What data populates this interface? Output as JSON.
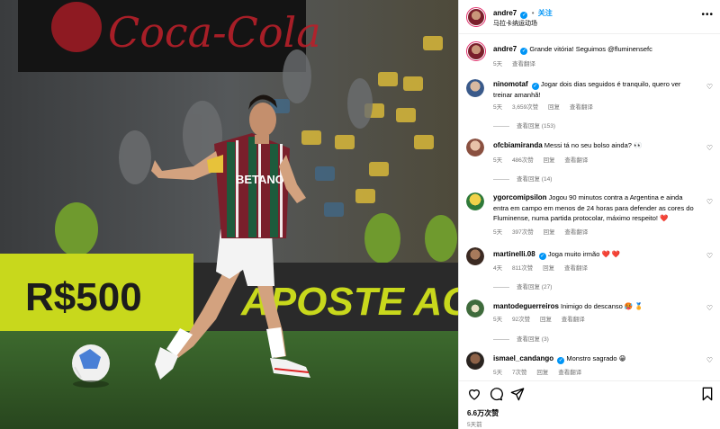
{
  "post": {
    "author": "andre7",
    "follow_label": "关注",
    "location": "马拉卡纳运动场",
    "caption_text": "Grande vitória! Seguimos @fluminensefc",
    "caption_time": "5天",
    "caption_translate": "查看翻译",
    "more_icon": "more-horizontal-icon"
  },
  "photo": {
    "ad_board_left": "R$500",
    "ad_board_right": "APOSTE AGO",
    "sponsor": "BETANO",
    "banner_brand": "Coca-Cola"
  },
  "comments": [
    {
      "user": "ninomotaf",
      "verified": true,
      "text": "Jogar dois dias seguidos é tranquilo, quero ver treinar amanhã!",
      "time": "5天",
      "likes": "3,659次赞",
      "reply": "回复",
      "translate": "查看翻译",
      "replies": "查看回复 (153)"
    },
    {
      "user": "ofcbiamiranda",
      "verified": false,
      "text": "Messi tá no seu bolso ainda? 👀",
      "time": "5天",
      "likes": "486次赞",
      "reply": "回复",
      "translate": "查看翻译",
      "replies": "查看回复 (14)"
    },
    {
      "user": "ygorcomipsilon",
      "verified": false,
      "text": "Jogou 90 minutos contra a Argentina e ainda entra em campo em menos de 24 horas para defender as cores do Fluminense, numa partida protocolar, máximo respeito! ❤️",
      "time": "5天",
      "likes": "397次赞",
      "reply": "回复",
      "translate": "查看翻译",
      "replies": ""
    },
    {
      "user": "martinelli.08",
      "verified": true,
      "text": "Joga muito irmão ❤️ ❤️",
      "time": "4天",
      "likes": "811次赞",
      "reply": "回复",
      "translate": "查看翻译",
      "replies": "查看回复 (27)"
    },
    {
      "user": "mantodeguerreiros",
      "verified": false,
      "text": "Inimigo do descanso 🥵 🏅",
      "time": "5天",
      "likes": "92次赞",
      "reply": "回复",
      "translate": "查看翻译",
      "replies": "查看回复 (3)"
    },
    {
      "user": "ismael_candango",
      "verified": true,
      "text": "Monstro sagrado 😁",
      "time": "5天",
      "likes": "7次赞",
      "reply": "回复",
      "translate": "查看翻译",
      "replies": ""
    }
  ],
  "footer": {
    "likes": "6.6万次赞",
    "time": "5天前"
  },
  "colors": {
    "accent": "#0095f6",
    "fluminense_maroon": "#7a1f2b",
    "fluminense_green": "#1d5b3c",
    "ad_yellow": "#c8d81c"
  }
}
